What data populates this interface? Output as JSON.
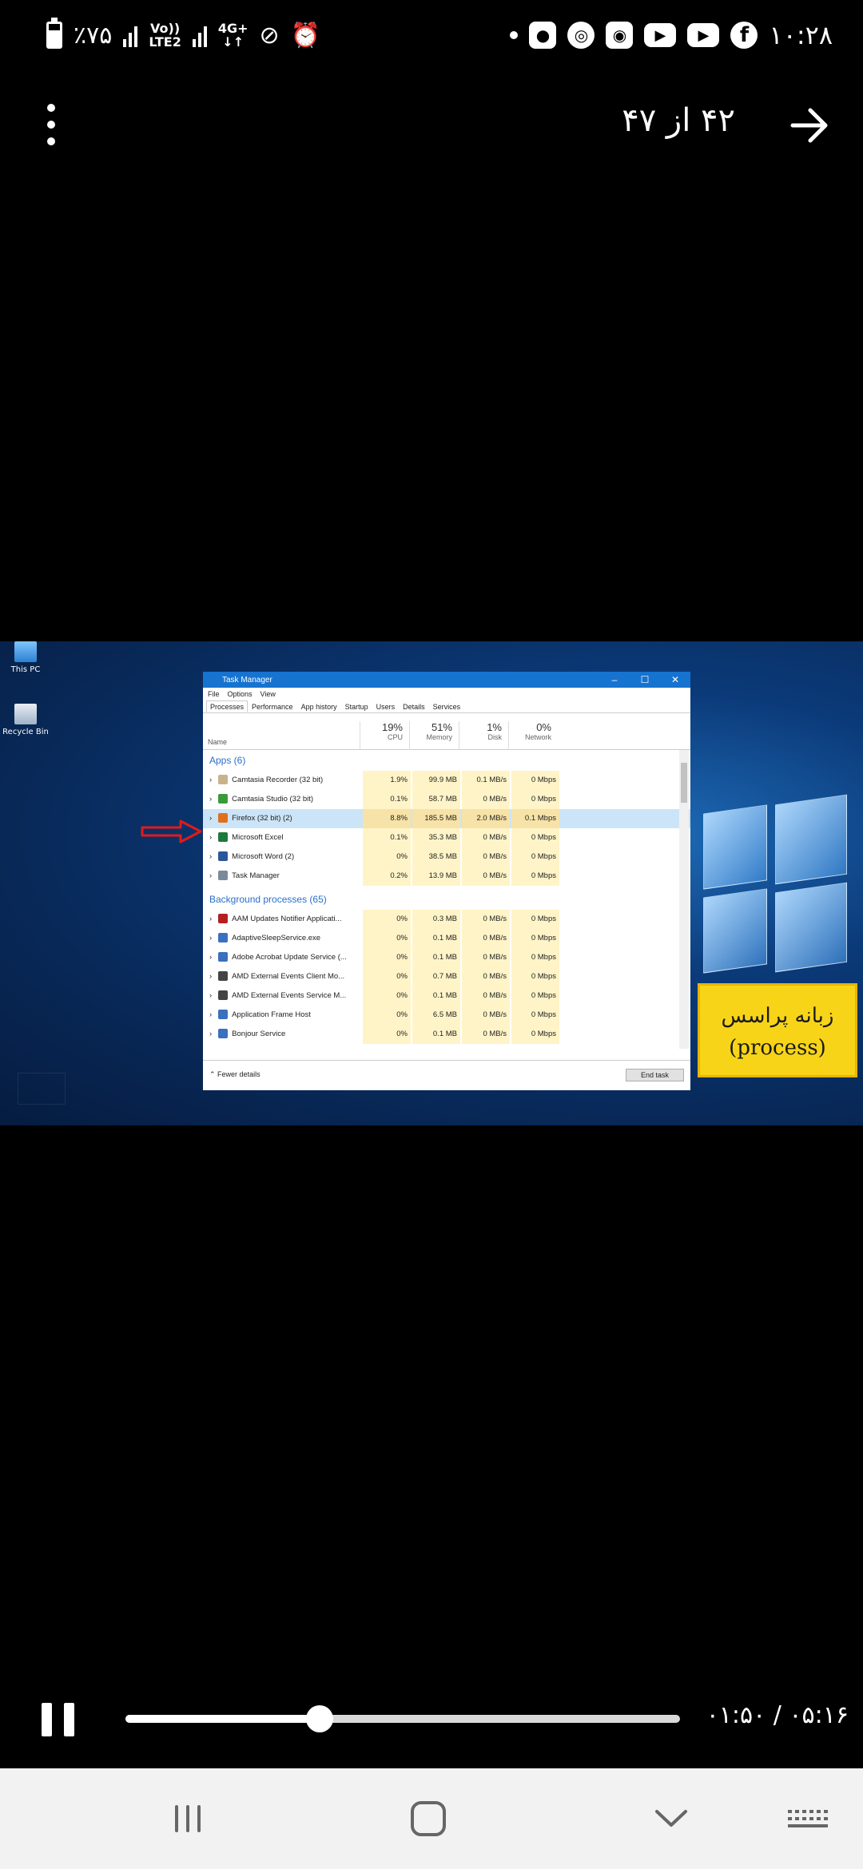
{
  "status_bar": {
    "battery": "٪۷۵",
    "network_volte": "Vo))",
    "network_lte": "LTE2",
    "network_4g": "4G+",
    "clock": "۱۰:۲۸"
  },
  "header": {
    "counter": "۴۲ از ۴۷"
  },
  "video_frame": {
    "desktop_icons": [
      "This PC",
      "Recycle Bin"
    ],
    "task_manager": {
      "title": "Task Manager",
      "menu": [
        "File",
        "Options",
        "View"
      ],
      "tabs": [
        "Processes",
        "Performance",
        "App history",
        "Startup",
        "Users",
        "Details",
        "Services"
      ],
      "columns": {
        "name": "Name",
        "cpu_pct": "19%",
        "cpu": "CPU",
        "mem_pct": "51%",
        "mem": "Memory",
        "disk_pct": "1%",
        "disk": "Disk",
        "net_pct": "0%",
        "net": "Network"
      },
      "apps_group": "Apps (6)",
      "apps": [
        {
          "name": "Camtasia Recorder (32 bit)",
          "cpu": "1.9%",
          "mem": "99.9 MB",
          "disk": "0.1 MB/s",
          "net": "0 Mbps"
        },
        {
          "name": "Camtasia Studio (32 bit)",
          "cpu": "0.1%",
          "mem": "58.7 MB",
          "disk": "0 MB/s",
          "net": "0 Mbps"
        },
        {
          "name": "Firefox (32 bit) (2)",
          "cpu": "8.8%",
          "mem": "185.5 MB",
          "disk": "2.0 MB/s",
          "net": "0.1 Mbps"
        },
        {
          "name": "Microsoft Excel",
          "cpu": "0.1%",
          "mem": "35.3 MB",
          "disk": "0 MB/s",
          "net": "0 Mbps"
        },
        {
          "name": "Microsoft Word (2)",
          "cpu": "0%",
          "mem": "38.5 MB",
          "disk": "0 MB/s",
          "net": "0 Mbps"
        },
        {
          "name": "Task Manager",
          "cpu": "0.2%",
          "mem": "13.9 MB",
          "disk": "0 MB/s",
          "net": "0 Mbps"
        }
      ],
      "bg_group": "Background processes (65)",
      "background": [
        {
          "name": "AAM Updates Notifier Applicati...",
          "cpu": "0%",
          "mem": "0.3 MB",
          "disk": "0 MB/s",
          "net": "0 Mbps"
        },
        {
          "name": "AdaptiveSleepService.exe",
          "cpu": "0%",
          "mem": "0.1 MB",
          "disk": "0 MB/s",
          "net": "0 Mbps"
        },
        {
          "name": "Adobe Acrobat Update Service (...",
          "cpu": "0%",
          "mem": "0.1 MB",
          "disk": "0 MB/s",
          "net": "0 Mbps"
        },
        {
          "name": "AMD External Events Client Mo...",
          "cpu": "0%",
          "mem": "0.7 MB",
          "disk": "0 MB/s",
          "net": "0 Mbps"
        },
        {
          "name": "AMD External Events Service M...",
          "cpu": "0%",
          "mem": "0.1 MB",
          "disk": "0 MB/s",
          "net": "0 Mbps"
        },
        {
          "name": "Application Frame Host",
          "cpu": "0%",
          "mem": "6.5 MB",
          "disk": "0 MB/s",
          "net": "0 Mbps"
        },
        {
          "name": "Bonjour Service",
          "cpu": "0%",
          "mem": "0.1 MB",
          "disk": "0 MB/s",
          "net": "0 Mbps"
        }
      ],
      "fewer_details": "Fewer details",
      "end_task": "End task"
    },
    "callout": {
      "line1": "زبانه پراسس",
      "line2": "(process)"
    }
  },
  "player": {
    "time": "۰۱:۵۰ / ۰۵:۱۶",
    "progress_fraction": 0.35
  }
}
